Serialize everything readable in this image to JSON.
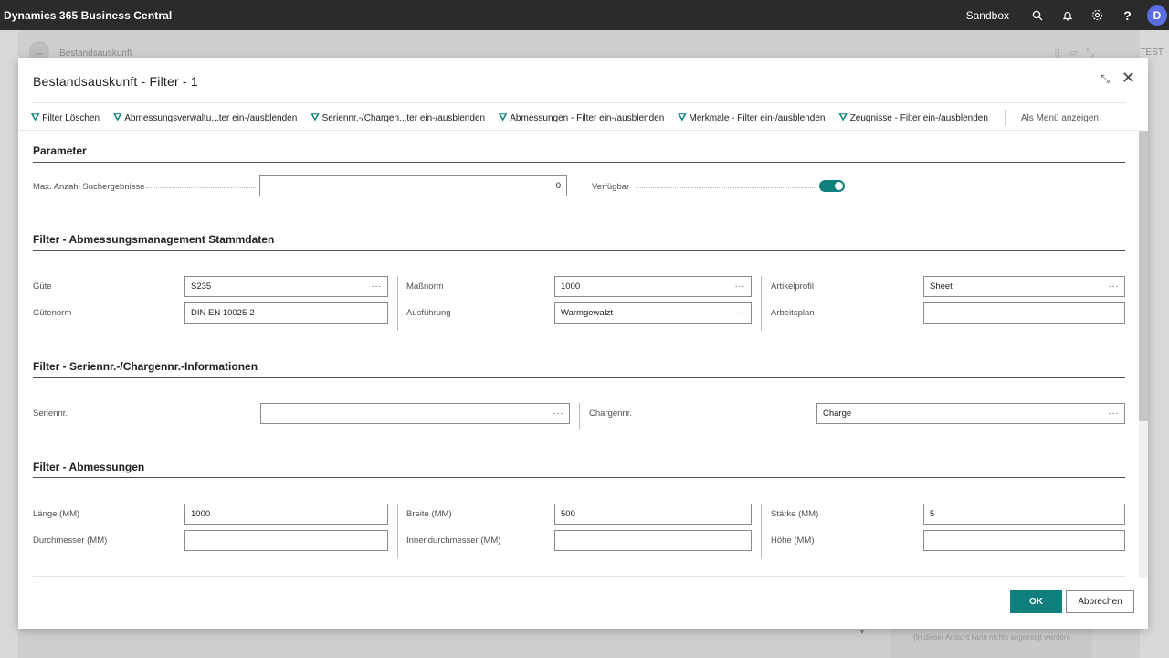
{
  "app": {
    "title": "Dynamics 365 Business Central",
    "environment": "Sandbox",
    "avatar_initial": "D",
    "icons": [
      "search-icon",
      "bell-icon",
      "gear-icon",
      "help-icon"
    ]
  },
  "background_page": {
    "title": "Bestandsauskunft",
    "env_badge": "TEST",
    "hint": "(In dieser Ansicht kann nichts angezeigt werden)"
  },
  "dialog": {
    "title": "Bestandsauskunft - Filter - 1",
    "actions": [
      {
        "label": "Filter Löschen",
        "icon": "filter-icon"
      },
      {
        "label": "Abmessungsverwaltu...ter ein-/ausblenden",
        "icon": "filter-icon"
      },
      {
        "label": "Seriennr.-/Chargen...ter ein-/ausblenden",
        "icon": "filter-icon"
      },
      {
        "label": "Abmessungen - Filter ein-/ausblenden",
        "icon": "filter-icon"
      },
      {
        "label": "Merkmale - Filter ein-/ausblenden",
        "icon": "filter-icon"
      },
      {
        "label": "Zeugnisse - Filter ein-/ausblenden",
        "icon": "filter-icon"
      }
    ],
    "show_as_menu": "Als Menü anzeigen",
    "sections": {
      "parameter": {
        "title": "Parameter",
        "max_results_label": "Max. Anzahl Suchergebnisse",
        "max_results_value": "0",
        "available_label": "Verfügbar",
        "available_on": true
      },
      "master": {
        "title": "Filter - Abmessungsmanagement Stammdaten",
        "guete_label": "Güte",
        "guete_value": "S235",
        "guetenorm_label": "Gütenorm",
        "guetenorm_value": "DIN EN 10025-2",
        "massnorm_label": "Maßnorm",
        "massnorm_value": "1000",
        "ausfuehrung_label": "Ausführung",
        "ausfuehrung_value": "Warmgewalzt",
        "artikelprofil_label": "Artikelprofil",
        "artikelprofil_value": "Sheet",
        "arbeitsplan_label": "Arbeitsplan",
        "arbeitsplan_value": ""
      },
      "serial": {
        "title": "Filter - Seriennr.-/Chargennr.-Informationen",
        "seriennr_label": "Seriennr.",
        "seriennr_value": "",
        "chargennr_label": "Chargennr.",
        "chargennr_value": "Charge"
      },
      "dimensions": {
        "title": "Filter - Abmessungen",
        "laenge_label": "Länge (MM)",
        "laenge_value": "1000",
        "durchmesser_label": "Durchmesser (MM)",
        "durchmesser_value": "",
        "breite_label": "Breite (MM)",
        "breite_value": "500",
        "innendurchmesser_label": "Innendurchmesser (MM)",
        "innendurchmesser_value": "",
        "staerke_label": "Stärke (MM)",
        "staerke_value": "5",
        "hoehe_label": "Höhe (MM)",
        "hoehe_value": ""
      }
    },
    "ok_label": "OK",
    "cancel_label": "Abbrechen"
  }
}
